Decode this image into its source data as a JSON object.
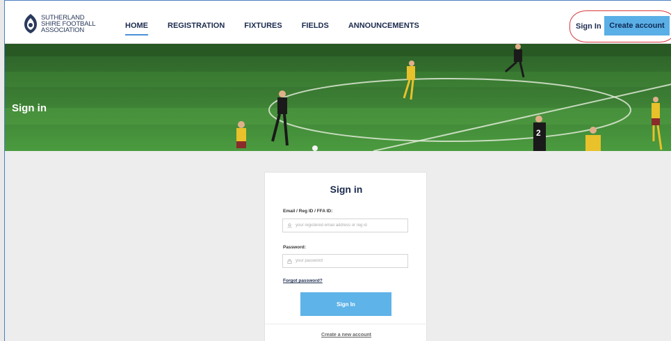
{
  "header": {
    "logo_lines": [
      "SUTHERLAND",
      "SHIRE FOOTBALL",
      "ASSOCIATION"
    ],
    "nav": [
      {
        "label": "HOME",
        "active": true
      },
      {
        "label": "REGISTRATION",
        "active": false
      },
      {
        "label": "FIXTURES",
        "active": false
      },
      {
        "label": "FIELDS",
        "active": false
      },
      {
        "label": "ANNOUNCEMENTS",
        "active": false
      }
    ],
    "signin_label": "Sign In",
    "create_account_label": "Create account"
  },
  "hero": {
    "title": "Sign in"
  },
  "form": {
    "title": "Sign in",
    "email_label": "Email / Reg ID / FFA ID:",
    "email_placeholder": "your registered email address or reg id",
    "password_label": "Password:",
    "password_placeholder": "your password",
    "forgot_label": "Forgot password?",
    "submit_label": "Sign In",
    "create_link_label": "Create a new account"
  },
  "colors": {
    "accent": "#5aafe6",
    "navy": "#1b2a4e",
    "annotation": "#d9383c"
  },
  "icons": {
    "logo": "shield-crest-icon",
    "email": "user-icon",
    "password": "lock-icon"
  }
}
